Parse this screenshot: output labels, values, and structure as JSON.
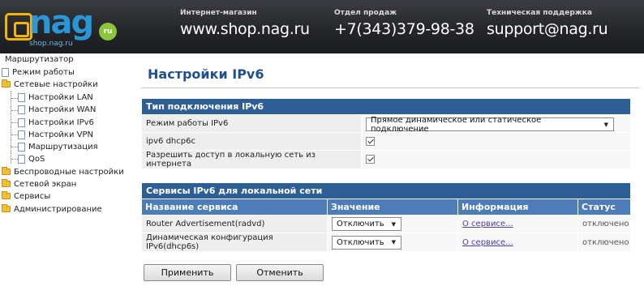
{
  "header": {
    "logo_text": "nag",
    "logo_sub": "shop.nag.ru",
    "logo_badge": "ru",
    "shop_caption": "Интернет-магазин",
    "shop_value": "www.shop.nag.ru",
    "sales_caption": "Отдел продаж",
    "sales_value": "+7(343)379-98-38",
    "support_caption": "Техническая поддержка",
    "support_value": "support@nag.ru"
  },
  "sidebar": {
    "title": "Маршрутизатор",
    "items": [
      {
        "label": "Режим работы",
        "icon": "page-icon"
      },
      {
        "label": "Сетевые настройки",
        "icon": "folder-open-icon"
      },
      {
        "label": "Настройки LAN",
        "icon": "page-icon"
      },
      {
        "label": "Настройки WAN",
        "icon": "page-icon"
      },
      {
        "label": "Настройки IPv6",
        "icon": "page-icon"
      },
      {
        "label": "Настройки VPN",
        "icon": "page-icon"
      },
      {
        "label": "Маршрутизация",
        "icon": "page-icon"
      },
      {
        "label": "QoS",
        "icon": "page-icon"
      },
      {
        "label": "Беспроводные настройки",
        "icon": "folder-icon"
      },
      {
        "label": "Сетевой экран",
        "icon": "folder-icon"
      },
      {
        "label": "Сервисы",
        "icon": "folder-icon"
      },
      {
        "label": "Администрирование",
        "icon": "folder-icon"
      }
    ]
  },
  "main": {
    "title": "Настройки IPv6",
    "connection": {
      "section_title": "Тип подключения IPv6",
      "rows": [
        {
          "label": "Режим работы IPv6",
          "value": "Прямое динамическое или статическое подключение"
        },
        {
          "label": "ipv6 dhcp6c",
          "checked": true
        },
        {
          "label": "Разрешить доступ в локальную сеть из интернета",
          "checked": true
        }
      ]
    },
    "services": {
      "section_title": "Сервисы IPv6 для локальной сети",
      "columns": [
        "Название сервиса",
        "Значение",
        "Информация",
        "Статус"
      ],
      "rows": [
        {
          "name": "Router Advertisement(radvd)",
          "value": "Отключить",
          "info": "О сервисе...",
          "status": "отключено"
        },
        {
          "name": "Динамическая конфигурация IPv6(dhcp6s)",
          "value": "Отключить",
          "info": "О сервисе...",
          "status": "отключено"
        }
      ]
    },
    "buttons": {
      "apply": "Применить",
      "cancel": "Отменить"
    }
  },
  "colors": {
    "header_bg": "#24262a",
    "logo_blue": "#2a96d6",
    "section_blue": "#2e5e96",
    "column_blue": "#4d7db8",
    "title_blue": "#1f4f8f"
  }
}
